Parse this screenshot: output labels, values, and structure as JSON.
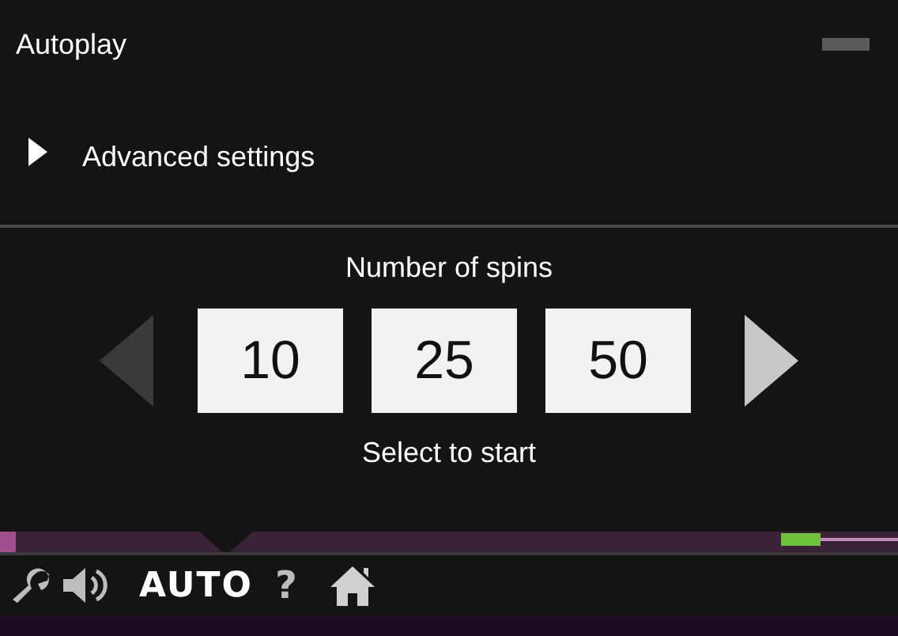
{
  "panel": {
    "title": "Autoplay"
  },
  "advanced": {
    "label": "Advanced settings",
    "expanded": false
  },
  "spins": {
    "heading": "Number of spins",
    "prev_disabled": true,
    "next_disabled": false,
    "options": [
      "10",
      "25",
      "50"
    ],
    "hint": "Select to start"
  },
  "toolbar": {
    "auto_label": "AUTO",
    "help_label": "?"
  }
}
